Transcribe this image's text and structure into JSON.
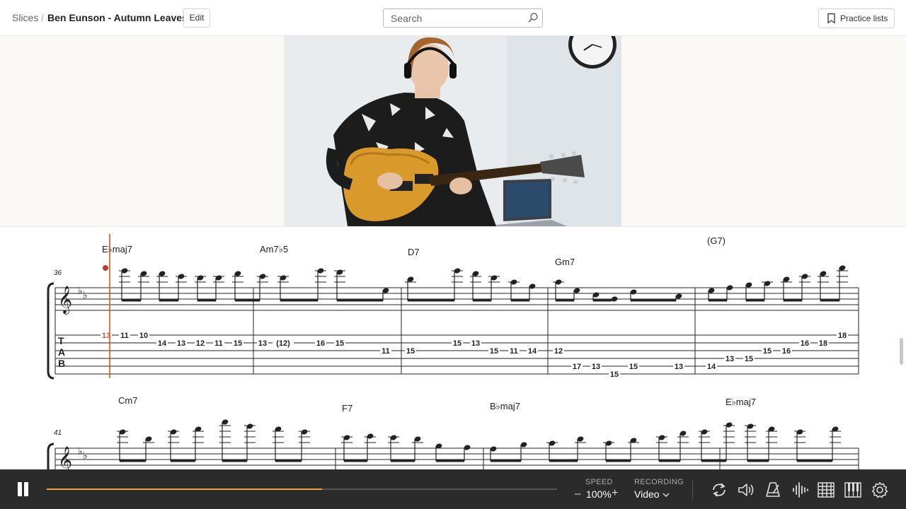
{
  "header": {
    "breadcrumb_root": "Slices",
    "breadcrumb_sep": "/",
    "title": "Ben Eunson - Autumn Leaves",
    "edit_label": "Edit",
    "search_placeholder": "Search",
    "practice_lists_label": "Practice lists"
  },
  "score": {
    "system1": {
      "measure_number": "36",
      "chords": [
        "E♭maj7",
        "Am7♭5",
        "D7",
        "Gm7",
        "(G7)"
      ],
      "tab_numbers": [
        "13",
        "11",
        "10",
        "14",
        "13",
        "12",
        "11",
        "15",
        "13",
        "(12)",
        "16",
        "15",
        "11",
        "15",
        "15",
        "13",
        "15",
        "11",
        "14",
        "12",
        "17",
        "13",
        "15",
        "15",
        "13",
        "14",
        "13",
        "15",
        "15",
        "16",
        "16",
        "18",
        "18"
      ]
    },
    "system2": {
      "measure_number": "41",
      "chords": [
        "Cm7",
        "F7",
        "B♭maj7",
        "E♭maj7"
      ]
    }
  },
  "player": {
    "progress": 0.54,
    "speed_label": "SPEED",
    "speed_value": "100%",
    "speed_minus": "–",
    "speed_plus": "+",
    "recording_label": "RECORDING",
    "recording_value": "Video"
  },
  "colors": {
    "accent": "#f0a53a",
    "playhead": "#d9532c",
    "player_bg": "#2b2b2b"
  }
}
